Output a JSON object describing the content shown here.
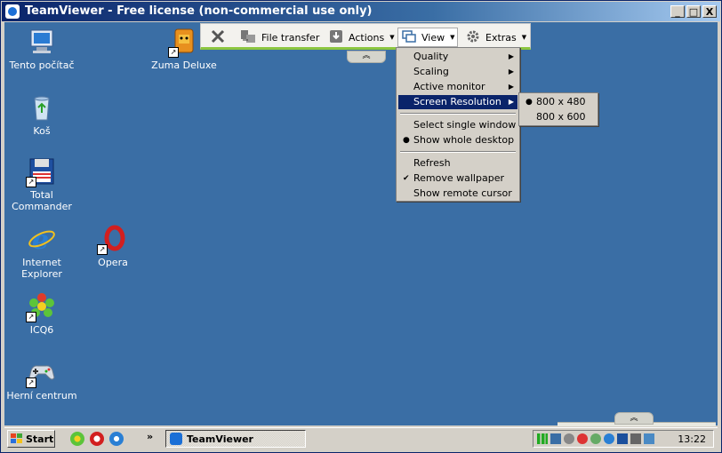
{
  "window": {
    "title": "TeamViewer - Free license (non-commercial use only)",
    "controls": [
      "_",
      "□",
      "X"
    ]
  },
  "desktop": {
    "icons": [
      {
        "label": "Tento počítač",
        "icon": "computer-icon"
      },
      {
        "label": "Koš",
        "icon": "recycle-bin-icon"
      },
      {
        "label": "Total Commander",
        "icon": "floppy-disk-icon"
      },
      {
        "label": "Internet Explorer",
        "icon": "internet-explorer-icon"
      },
      {
        "label": "ICQ6",
        "icon": "icq-flower-icon"
      },
      {
        "label": "Herní centrum",
        "icon": "gamepad-icon"
      },
      {
        "label": "Zuma Deluxe",
        "icon": "zuma-icon"
      },
      {
        "label": "Opera",
        "icon": "opera-icon"
      }
    ]
  },
  "toolbar": {
    "close_icon": "close-icon",
    "file_transfer": "File transfer",
    "actions": "Actions",
    "view": "View",
    "extras": "Extras",
    "collapse": "︽"
  },
  "view_menu": {
    "items": [
      "Quality",
      "Scaling",
      "Active monitor",
      "Screen Resolution",
      "Select single window",
      "Show whole desktop",
      "Refresh",
      "Remove wallpaper",
      "Show remote cursor"
    ],
    "highlighted": "Screen Resolution",
    "checked": "Remove wallpaper",
    "selected_radio": "Show whole desktop"
  },
  "resolution_submenu": {
    "items": [
      "800 x 480",
      "800 x 600"
    ],
    "selected": "800 x 480"
  },
  "taskbar": {
    "start": "Start",
    "chevron": "»",
    "task": "TeamViewer",
    "clock": "13:22"
  },
  "colors": {
    "desktop": "#3a6ea5",
    "titlebar": "#0a246a",
    "menu_highlight": "#0a246a",
    "accent_green": "#8cc63f"
  }
}
